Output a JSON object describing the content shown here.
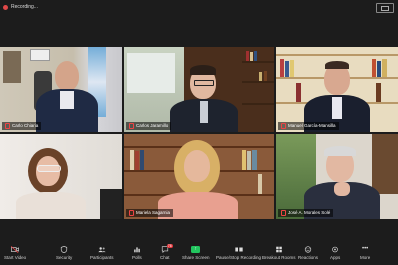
{
  "topbar": {
    "recording_label": "Recording..."
  },
  "participants": [
    {
      "name": "Carlo Chiaria"
    },
    {
      "name": "Carlos Jaramillo"
    },
    {
      "name": "Manuel García-Mansilla"
    },
    {
      "name": ""
    },
    {
      "name": "Mariela Sagarnia"
    },
    {
      "name": "José A. Morales Solé"
    }
  ],
  "toolbar": {
    "items": [
      {
        "label": "Start Video",
        "icon": "video-off-icon"
      },
      {
        "label": "Security",
        "icon": "shield-icon"
      },
      {
        "label": "Participants",
        "icon": "participants-icon",
        "count": "8"
      },
      {
        "label": "Polls",
        "icon": "polls-icon"
      },
      {
        "label": "Chat",
        "icon": "chat-icon",
        "badge": "76"
      },
      {
        "label": "Share Screen",
        "icon": "share-screen-icon"
      },
      {
        "label": "Pause/Stop Recording",
        "icon": "recording-icon"
      },
      {
        "label": "Breakout Rooms",
        "icon": "breakout-rooms-icon"
      },
      {
        "label": "Reactions",
        "icon": "reactions-icon"
      },
      {
        "label": "Apps",
        "icon": "apps-icon"
      },
      {
        "label": "More",
        "icon": "more-icon"
      }
    ],
    "accent_green": "#22c55e"
  }
}
